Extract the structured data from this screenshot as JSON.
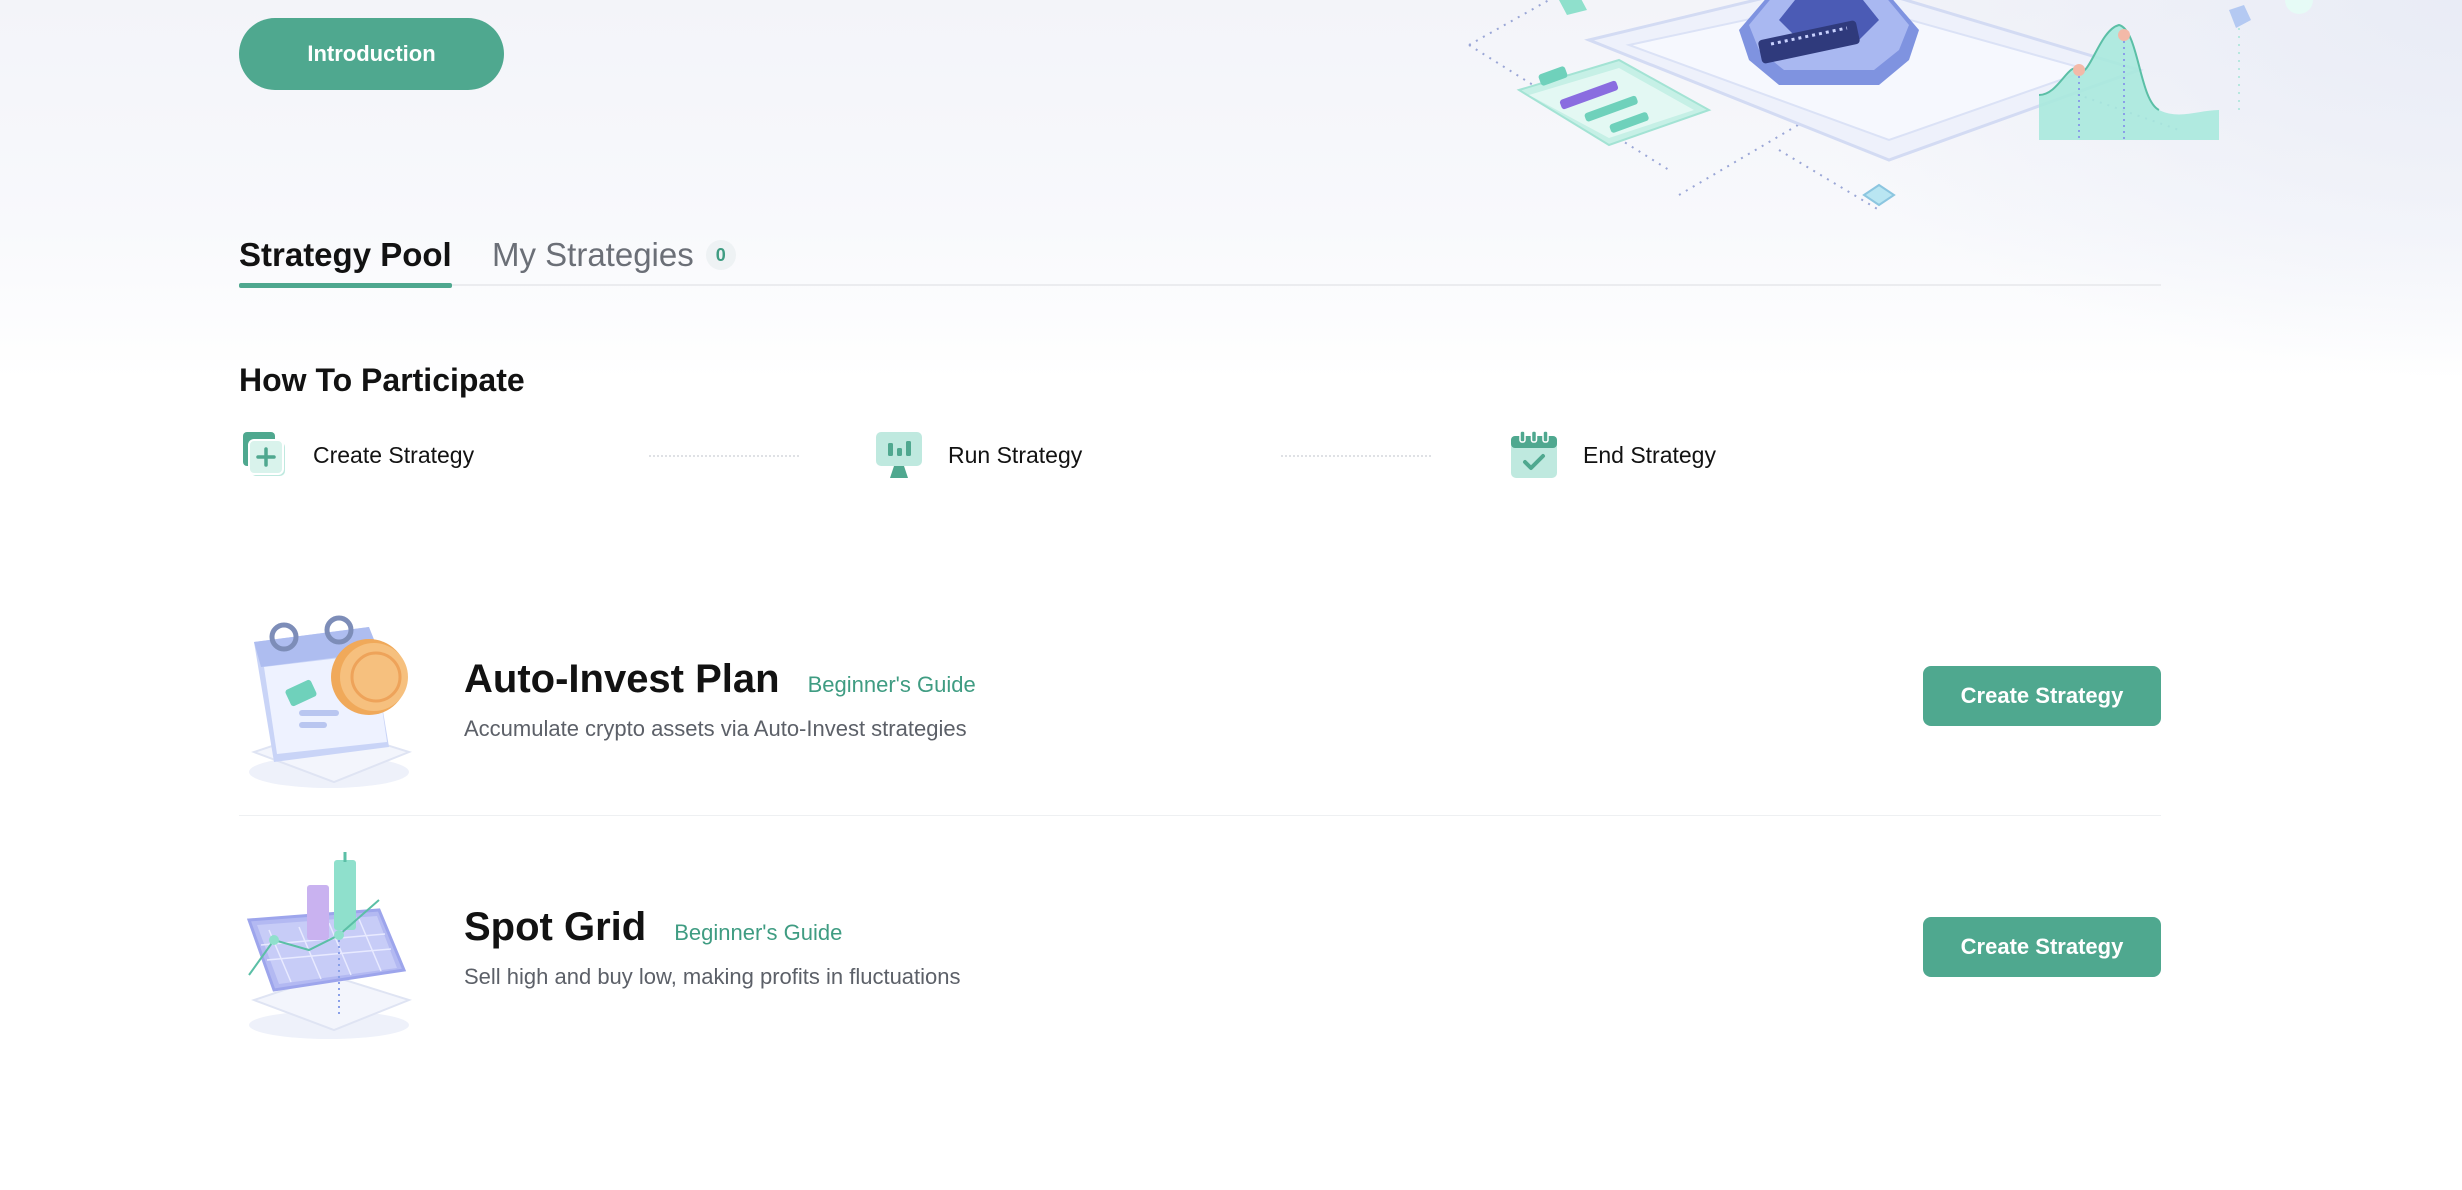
{
  "hero": {
    "intro_button_label": "Introduction"
  },
  "tabs": [
    {
      "label": "Strategy Pool",
      "active": true
    },
    {
      "label": "My Strategies",
      "badge": "0",
      "active": false
    }
  ],
  "participate": {
    "title": "How To Participate",
    "steps": [
      {
        "label": "Create Strategy",
        "icon": "create-strategy-icon"
      },
      {
        "label": "Run Strategy",
        "icon": "run-strategy-icon"
      },
      {
        "label": "End Strategy",
        "icon": "end-strategy-icon"
      }
    ]
  },
  "strategies": [
    {
      "name": "Auto-Invest Plan",
      "guide_label": "Beginner's Guide",
      "description": "Accumulate crypto assets via Auto-Invest strategies",
      "button_label": "Create Strategy",
      "illustration": "calendar-coin-illustration"
    },
    {
      "name": "Spot Grid",
      "guide_label": "Beginner's Guide",
      "description": "Sell high and buy low, making profits in fluctuations",
      "button_label": "Create Strategy",
      "illustration": "grid-chart-illustration"
    }
  ],
  "colors": {
    "accent": "#4fa88f",
    "accent_text": "#3f9c82",
    "primary_text": "#121212",
    "secondary_text": "#5c6068"
  }
}
